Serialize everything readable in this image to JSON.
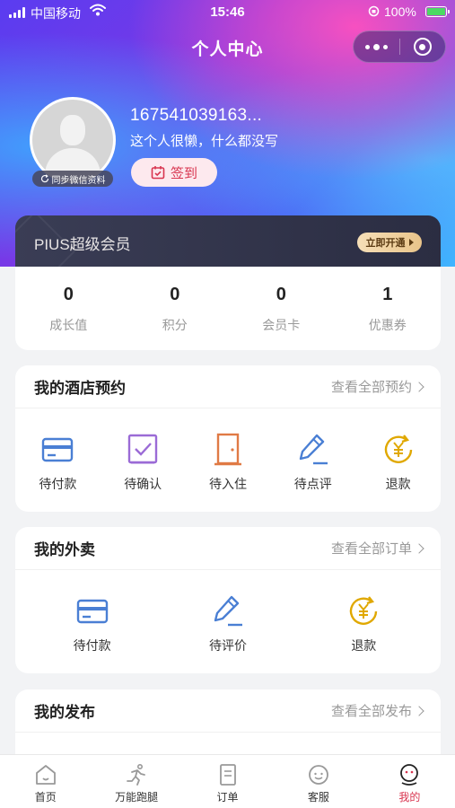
{
  "status_bar": {
    "carrier": "中国移动",
    "time": "15:46",
    "battery": "100%"
  },
  "nav": {
    "title": "个人中心"
  },
  "profile": {
    "username": "167541039163...",
    "bio": "这个人很懒，什么都没写",
    "sync_label": "同步微信资料",
    "signin_label": "签到"
  },
  "membership": {
    "title": "PIUS超级会员",
    "action_label": "立即开通"
  },
  "stats": [
    {
      "value": "0",
      "label": "成长值"
    },
    {
      "value": "0",
      "label": "积分"
    },
    {
      "value": "0",
      "label": "会员卡"
    },
    {
      "value": "1",
      "label": "优惠券"
    }
  ],
  "hotel": {
    "title": "我的酒店预约",
    "link": "查看全部预约",
    "items": [
      {
        "label": "待付款",
        "icon": "card-icon"
      },
      {
        "label": "待确认",
        "icon": "check-box-icon"
      },
      {
        "label": "待入住",
        "icon": "door-icon"
      },
      {
        "label": "待点评",
        "icon": "pen-icon"
      },
      {
        "label": "退款",
        "icon": "refund-icon"
      }
    ]
  },
  "takeout": {
    "title": "我的外卖",
    "link": "查看全部订单",
    "items": [
      {
        "label": "待付款",
        "icon": "card-icon"
      },
      {
        "label": "待评价",
        "icon": "pen-icon"
      },
      {
        "label": "退款",
        "icon": "refund-icon"
      }
    ]
  },
  "publish": {
    "title": "我的发布",
    "link": "查看全部发布"
  },
  "tabbar": [
    {
      "label": "首页",
      "icon": "home-icon"
    },
    {
      "label": "万能跑腿",
      "icon": "runner-icon"
    },
    {
      "label": "订单",
      "icon": "order-icon"
    },
    {
      "label": "客服",
      "icon": "service-icon"
    },
    {
      "label": "我的",
      "icon": "profile-icon",
      "active": true
    }
  ],
  "colors": {
    "accent": "#d8344f",
    "icon_blue": "#4a7fd4",
    "icon_purple": "#9b6bd6",
    "icon_orange": "#e07a45",
    "icon_gold": "#e0a800"
  }
}
